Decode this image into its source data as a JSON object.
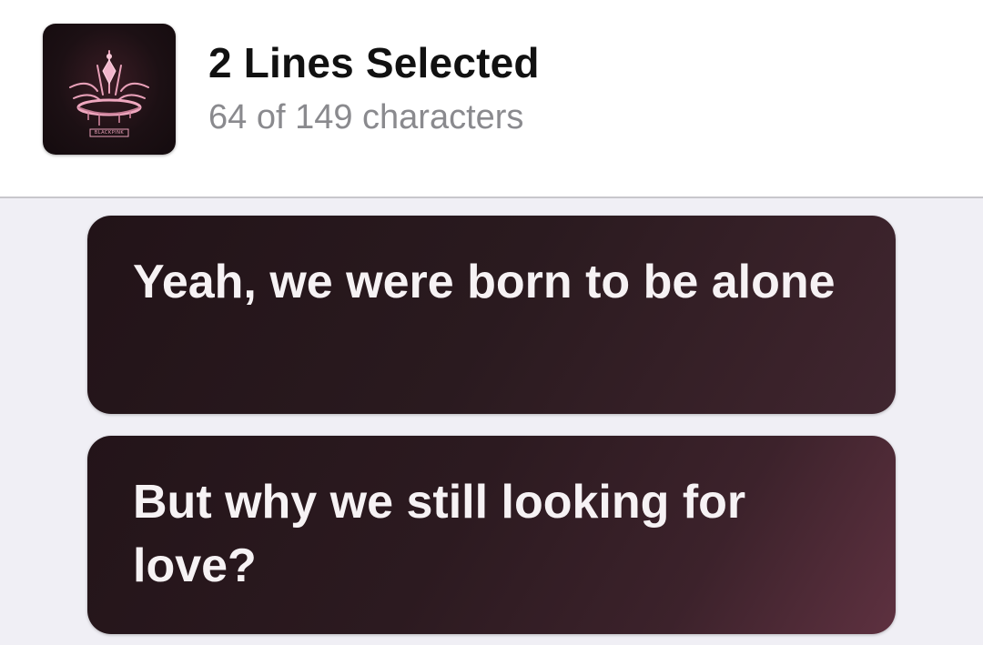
{
  "header": {
    "artwork_icon": "album-artwork-crown",
    "artwork_text": "BLACKPINK",
    "title": "2 Lines Selected",
    "subtitle": "64 of 149 characters"
  },
  "lyrics": [
    {
      "text": "Yeah, we were born to be alone"
    },
    {
      "text": "But why we still looking for love?"
    }
  ],
  "colors": {
    "background": "#f0eff5",
    "header_background": "#ffffff",
    "card_gradient_start": "#231419",
    "card_gradient_end": "#5e3140",
    "lyric_text": "#f6f2f4",
    "subtitle_text": "#8a8a8e"
  }
}
